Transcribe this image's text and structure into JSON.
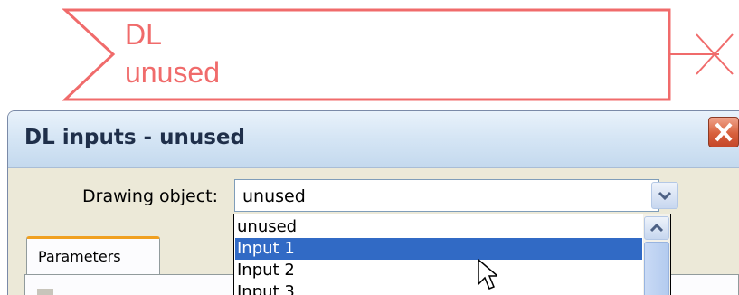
{
  "block": {
    "line1": "DL",
    "line2": "unused",
    "color": "#f06b6b"
  },
  "dialog": {
    "title": "DL inputs - unused",
    "close_icon": "close-icon",
    "field_label": "Drawing object:",
    "field_value": "unused",
    "tab_label": "Parameters"
  },
  "dropdown": {
    "options": [
      "unused",
      "Input 1",
      "Input 2",
      "Input 3"
    ],
    "selected_index": 1
  },
  "colors": {
    "selection": "#316ac5",
    "close_button": "#d8603c",
    "tab_highlight": "#f0a020"
  }
}
